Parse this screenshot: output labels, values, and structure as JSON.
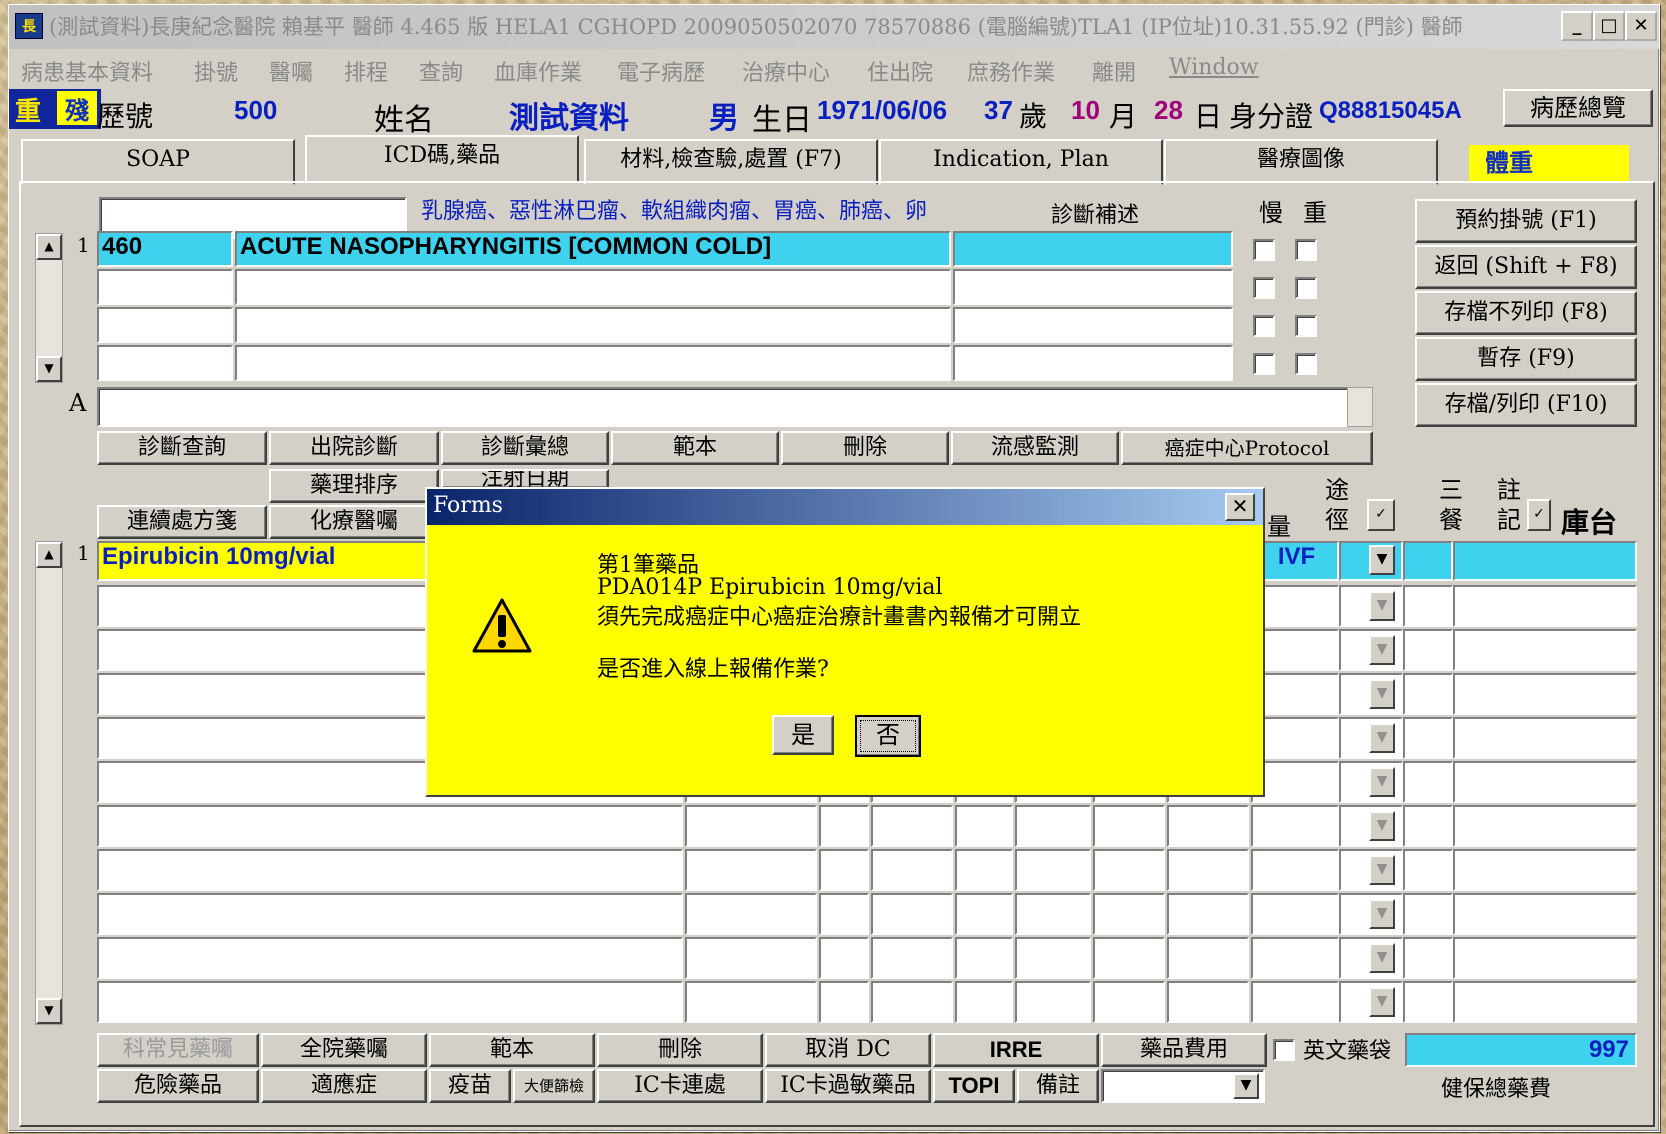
{
  "window": {
    "title": "(測試資料)長庚紀念醫院 賴基平 醫師 4.465 版 HELA1 CGHOPD 2009050502070 78570886 (電腦編號)TLA1 (IP位址)10.31.55.92 (門診) 醫師",
    "minimize": "_",
    "maximize": "□",
    "close": "✕",
    "app_icon": "app-icon"
  },
  "menu": [
    "病患基本資料",
    "掛號",
    "醫囑",
    "排程",
    "查詢",
    "血庫作業",
    "電子病歷",
    "治療中心",
    "住出院",
    "庶務作業",
    "離開",
    "Window"
  ],
  "patient": {
    "badge_heavy": "重",
    "badge_critical": "殘",
    "chart_label": "歷號",
    "chart_no": "500",
    "name_label": "姓名",
    "name": "測試資料",
    "sex": "男",
    "birth_label": "生日",
    "birth": "1971/06/06",
    "age": "37",
    "age_unit": "歲",
    "month": "10",
    "month_unit": "月",
    "day": "28",
    "day_unit": "日",
    "id_label": "身分證",
    "id_no": "Q88815045A",
    "history_button": "病歷總覽"
  },
  "tabs": [
    "SOAP",
    "ICD碼,藥品",
    "材料,檢查驗,處置 (F7)",
    "Indication, Plan",
    "醫療圖像"
  ],
  "weight_label": "體重",
  "diagnosis": {
    "search_value": "",
    "cancer_hint": "乳腺癌、惡性淋巴瘤、軟組織肉瘤、胃癌、肺癌、卵",
    "supplement_header": "診斷補述",
    "chronic_header": "慢",
    "severe_header": "重",
    "row_no": "1",
    "rows": [
      {
        "code": "460",
        "desc": "ACUTE NASOPHARYNGITIS [COMMON COLD]",
        "note": ""
      },
      {
        "code": "",
        "desc": "",
        "note": ""
      },
      {
        "code": "",
        "desc": "",
        "note": ""
      },
      {
        "code": "",
        "desc": "",
        "note": ""
      }
    ],
    "a_label": "A",
    "buttons": [
      "診斷查詢",
      "出院診斷",
      "診斷彙總",
      "範本",
      "刪除",
      "流感監測",
      "癌症中心Protocol"
    ]
  },
  "right_buttons": [
    "預約掛號 (F1)",
    "返回 (Shift + F8)",
    "存檔不列印 (F8)",
    "暫存 (F9)",
    "存檔/列印 (F10)"
  ],
  "rx": {
    "top_buttons": [
      "藥理排序",
      "注射日期"
    ],
    "continuous": "連續處方箋",
    "chemo": "化療醫囑",
    "hdr_qty": "量",
    "hdr_route": "途徑",
    "hdr_meal": "三餐",
    "hdr_note": "註記",
    "hdr_store": "庫台",
    "row_no": "1",
    "first_drug": "Epirubicin 10mg/vial",
    "first_route": "IVF",
    "check": "✓"
  },
  "bottom": {
    "row1": [
      "科常見藥囑",
      "全院藥囑",
      "範本",
      "刪除",
      "取消 DC",
      "IRRE",
      "藥品費用"
    ],
    "english_bag": "英文藥袋",
    "total": "997",
    "row2": [
      "危險藥品",
      "適應症",
      "疫苗",
      "大便篩檢",
      "IC卡連處",
      "IC卡過敏藥品",
      "TOPI",
      "備註"
    ],
    "insurance_label": "健保總藥費"
  },
  "dialog": {
    "title": "Forms",
    "line1": "第1筆藥品",
    "line2": "PDA014P Epirubicin 10mg/vial",
    "line3": "須先完成癌症中心癌症治療計畫書內報備才可開立",
    "line4": "是否進入線上報備作業?",
    "yes": "是",
    "no": "否",
    "icon": "warning-icon",
    "close": "✕"
  },
  "colors": {
    "cyan": "#3fd2ee",
    "dialog": "#ffff00",
    "blue_text": "#0a1fbf",
    "magenta": "#a0007a"
  }
}
